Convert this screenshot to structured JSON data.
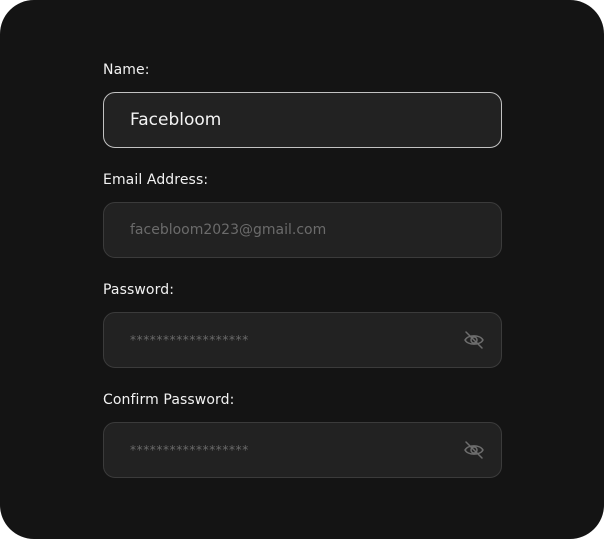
{
  "form": {
    "name": {
      "label": "Name:",
      "value": "Facebloom"
    },
    "email": {
      "label": "Email Address:",
      "placeholder": "facebloom2023@gmail.com"
    },
    "password": {
      "label": "Password:",
      "masked_value": "******************",
      "toggle_icon": "eye-off-icon"
    },
    "confirm_password": {
      "label": "Confirm Password:",
      "masked_value": "******************",
      "toggle_icon": "eye-off-icon"
    }
  },
  "colors": {
    "card_background": "#141414",
    "input_background": "#222222",
    "input_border": "#3b3b3b",
    "active_border": "#c2c2c2",
    "label_text": "#f2f2f2",
    "placeholder_text": "#6b6b6b"
  }
}
